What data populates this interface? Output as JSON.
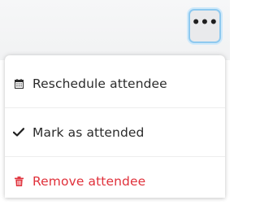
{
  "more_button": {
    "icon": "more-horizontal-icon",
    "glyph": "•••"
  },
  "menu": {
    "items": [
      {
        "label": "Reschedule attendee",
        "icon": "calendar-icon",
        "color": "#2b2b2b"
      },
      {
        "label": "Mark as attended",
        "icon": "check-icon",
        "color": "#2b2b2b"
      },
      {
        "label": "Remove attendee",
        "icon": "trash-icon",
        "color": "#e0313b"
      }
    ]
  },
  "colors": {
    "accent_border": "#8ec9ef",
    "danger": "#e0313b",
    "text": "#2b2b2b"
  }
}
